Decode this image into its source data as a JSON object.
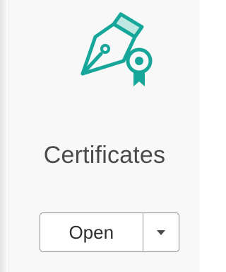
{
  "tool": {
    "title": "Certificates",
    "icon": "pen-certificate-icon",
    "accent_color": "#17a79a",
    "accent_fill_color": "#bfe8e2"
  },
  "actions": {
    "open_label": "Open",
    "menu_icon": "chevron-down-icon"
  }
}
